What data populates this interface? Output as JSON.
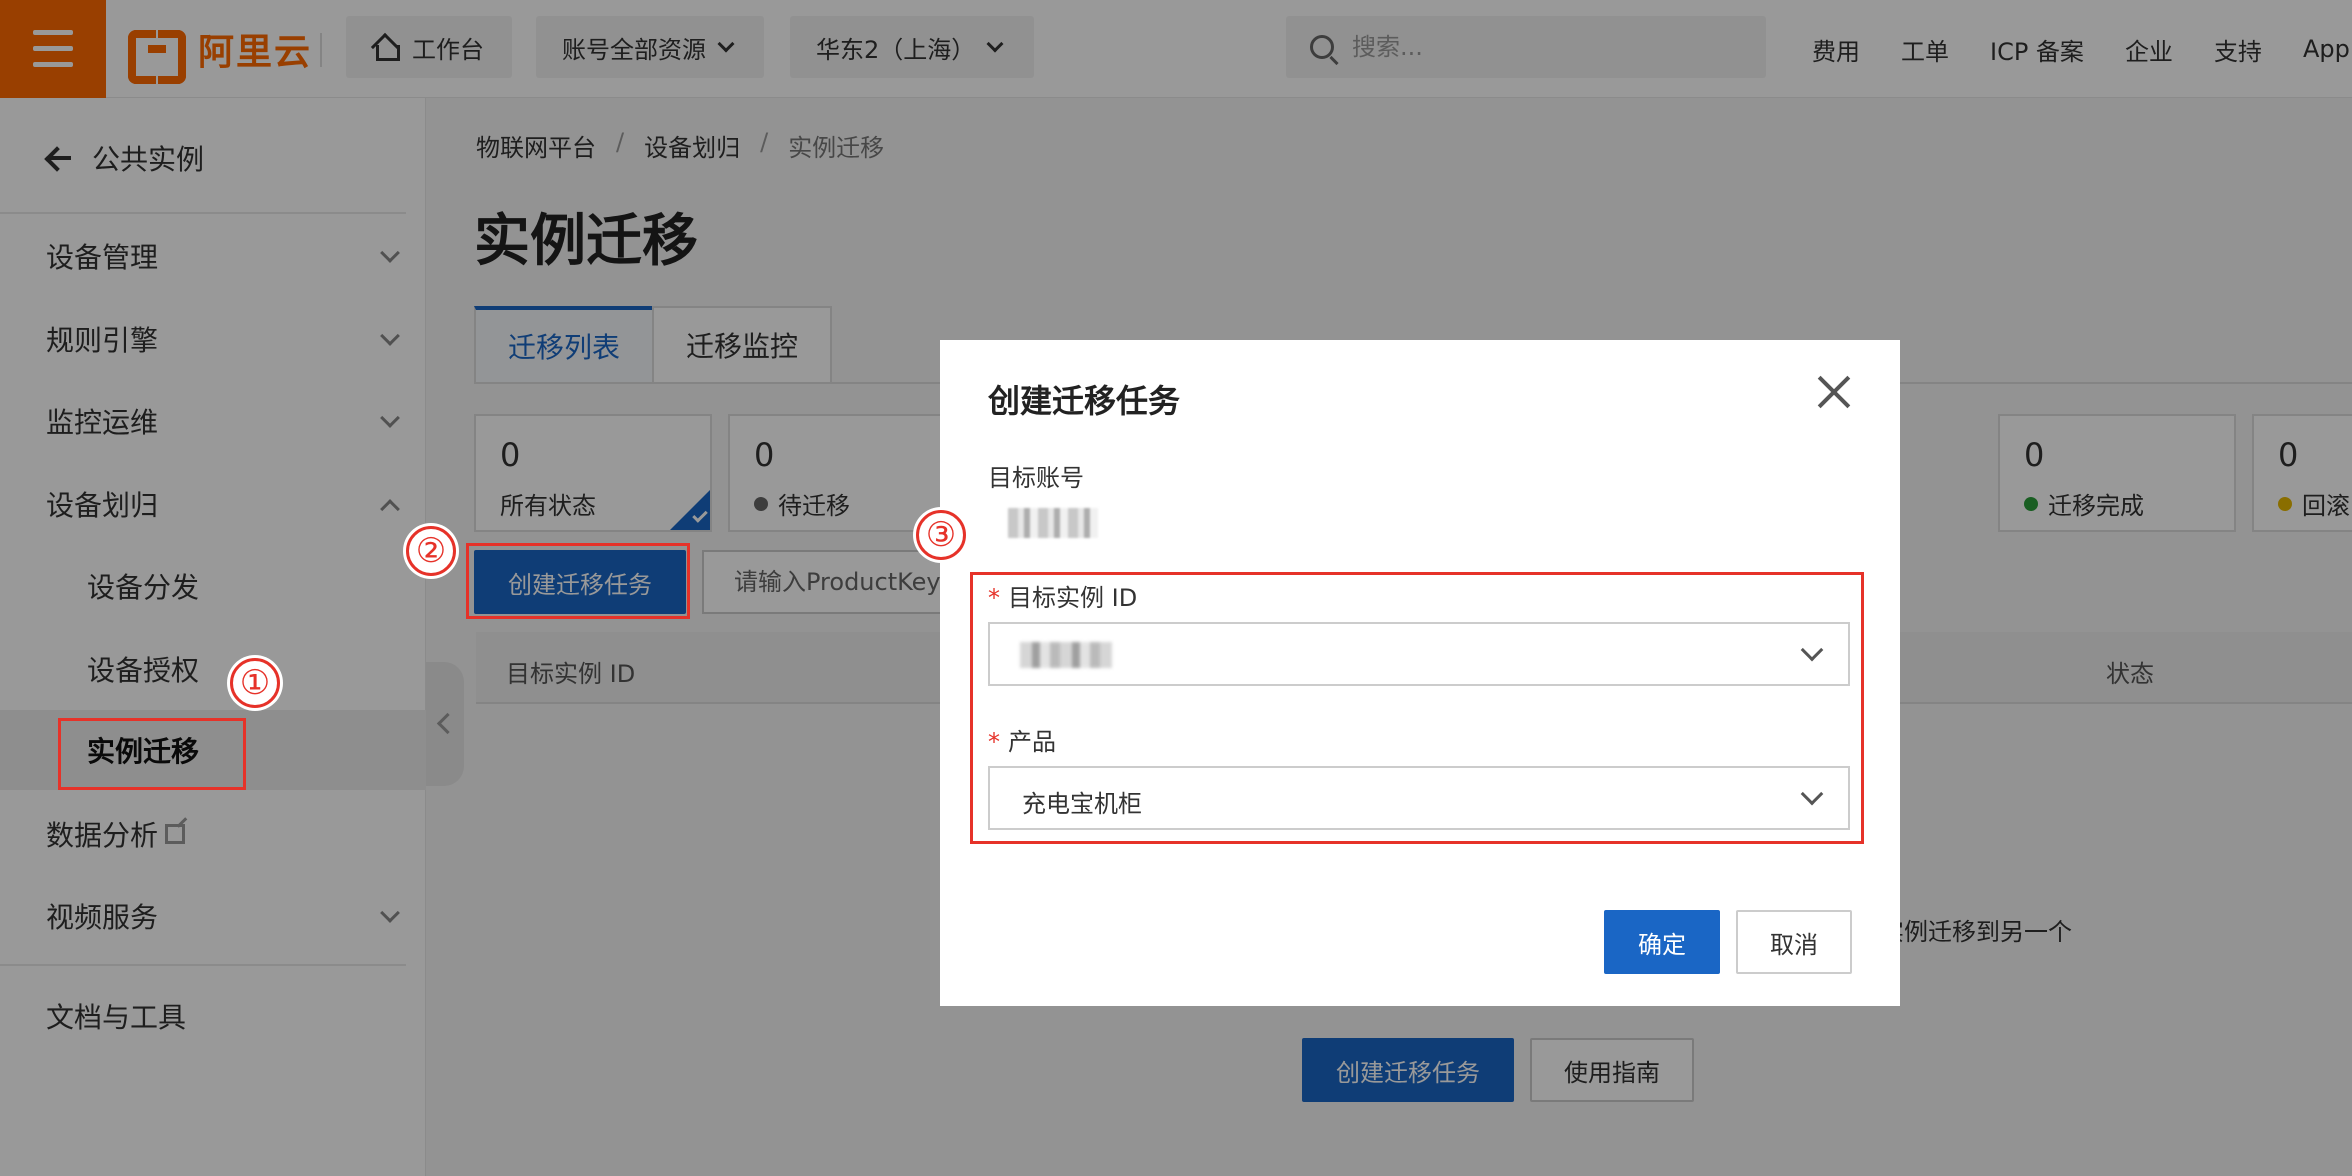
{
  "topbar": {
    "logo_text": "阿里云",
    "workbench": "工作台",
    "resources": "账号全部资源",
    "region": "华东2（上海）",
    "search_placeholder": "搜索...",
    "links": [
      "费用",
      "工单",
      "ICP 备案",
      "企业",
      "支持",
      "App"
    ],
    "brand_color": "#ff6a00"
  },
  "sidebar": {
    "back_label": "公共实例",
    "items": [
      {
        "label": "设备管理"
      },
      {
        "label": "规则引擎"
      },
      {
        "label": "监控运维"
      },
      {
        "label": "设备划归"
      },
      {
        "label": "设备分发"
      },
      {
        "label": "设备授权"
      },
      {
        "label": "实例迁移"
      },
      {
        "label": "数据分析"
      },
      {
        "label": "视频服务"
      },
      {
        "label": "文档与工具"
      }
    ]
  },
  "main": {
    "breadcrumb": [
      "物联网平台",
      "设备划归",
      "实例迁移"
    ],
    "title": "实例迁移",
    "tabs": [
      "迁移列表",
      "迁移监控"
    ],
    "stats": [
      {
        "count": "0",
        "label": "所有状态"
      },
      {
        "count": "0",
        "label": "待迁移"
      },
      {
        "count": "0",
        "label": "迁移完成"
      },
      {
        "count": "0",
        "label": "回滚"
      }
    ],
    "create_button": "创建迁移任务",
    "filter_placeholder": "请输入ProductKey",
    "table_columns": [
      "目标实例 ID",
      "状态"
    ],
    "empty_text": "实例迁移到另一个",
    "empty_create_button": "创建迁移任务",
    "guide_button": "使用指南"
  },
  "modal": {
    "title": "创建迁移任务",
    "target_account_label": "目标账号",
    "required_mark": "*",
    "instance_label": "目标实例 ID",
    "product_label": "产品",
    "product_value": "充电宝机柜",
    "ok_button": "确定",
    "cancel_button": "取消"
  },
  "annotations": {
    "step1": "①",
    "step2": "②",
    "step3": "③",
    "color": "#e63229"
  }
}
